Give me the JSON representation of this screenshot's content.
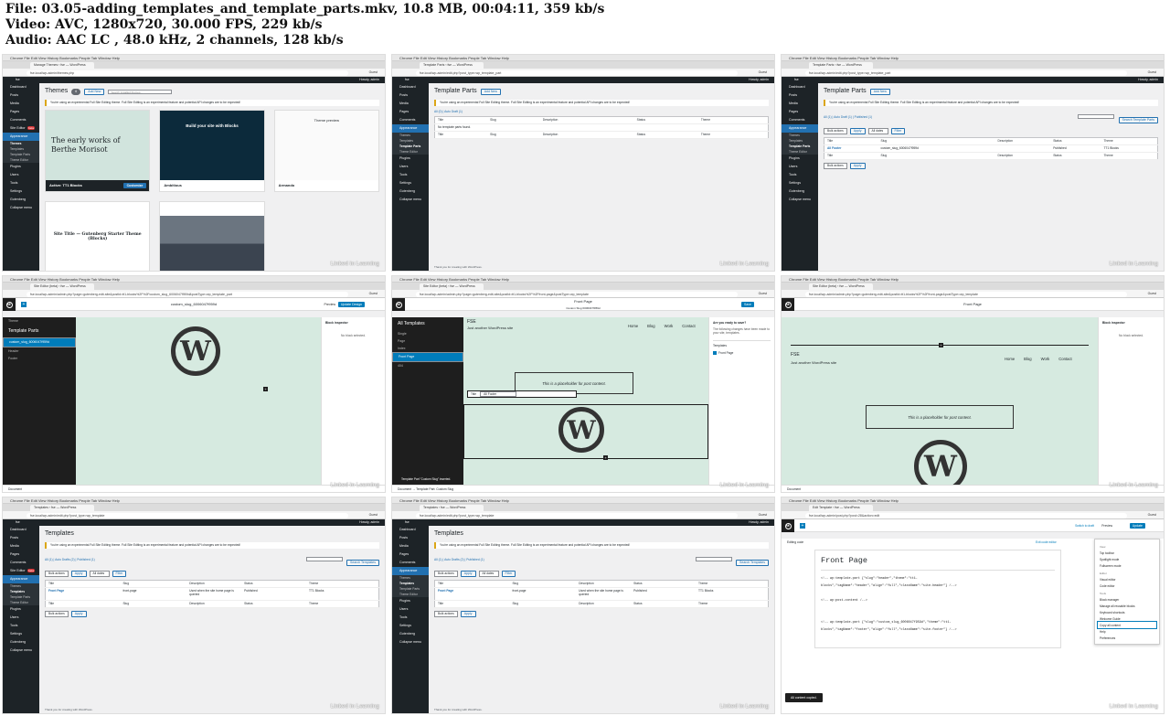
{
  "header": {
    "file_line": "File: 03.05-adding_templates_and_template_parts.mkv, 10.8 MB, 00:04:11, 359 kb/s",
    "video_line": "Video: AVC, 1280x720, 30.000 FPS, 229 kb/s",
    "audio_line": "Audio: AAC LC , 48.0 kHz, 2 channels, 128 kb/s"
  },
  "chrome": {
    "os_menu": "Chrome  File  Edit  View  History  Bookmarks  People  Tab  Window  Help",
    "guest": "Guest",
    "not_secure": "Not Secure"
  },
  "admin": {
    "site": "fse",
    "howdy": "Howdy, admin",
    "menu": [
      "Dashboard",
      "Posts",
      "Media",
      "Pages",
      "Comments",
      "Site Editor",
      "Appearance",
      "Plugins",
      "Users",
      "Tools",
      "Settings",
      "Gutenberg",
      "Collapse menu"
    ],
    "beta": "beta",
    "appearance_sub": [
      "Themes",
      "Templates",
      "Template Parts",
      "Theme Editor"
    ],
    "notice": "You're using an experimental Full Site Editing theme. Full Site Editing is an experimental feature and potential API changes are to be expected!",
    "thanks": "Thank you for creating with WordPress.",
    "version": "Version 5.8",
    "bulk": "Bulk actions",
    "apply": "Apply",
    "all_dates": "All dates",
    "filter": "Filter",
    "col_title": "Title",
    "col_slug": "Slug",
    "col_desc": "Description",
    "col_status": "Status",
    "col_theme": "Theme"
  },
  "linkedin": "Linked in Learning",
  "thumbs": {
    "t1": {
      "tab": "Manage Themes ‹ fse — WordPress",
      "url": "fse.local/wp-admin/themes.php",
      "title": "Themes",
      "count": "6",
      "add_new": "Add New",
      "search_ph": "Search installed themes...",
      "themes": [
        {
          "name": "Active: TT1 Blocks",
          "headline": "The early works of Berthe Morisot",
          "action": "Customize"
        },
        {
          "name": "Ambitious",
          "headline": "Build your site with Blocks"
        },
        {
          "name": "Armando",
          "headline": "Theme preview"
        },
        {
          "name": "",
          "headline": "Site Title — Gutenberg Starter Theme (Blocks)"
        },
        {
          "name": "",
          "headline": ""
        }
      ]
    },
    "t2": {
      "tab": "Template Parts ‹ fse — WordPress",
      "url": "fse.local/wp-admin/edit.php?post_type=wp_template_part",
      "title": "Template Parts",
      "add_new": "Add New",
      "subsub": "All (0) | Auto Draft (1)",
      "empty": "No template parts found."
    },
    "t3": {
      "tab": "Template Parts ‹ fse — WordPress",
      "url": "fse.local/wp-admin/edit.php?post_type=wp_template_part",
      "title": "Template Parts",
      "add_new": "Add New",
      "subsub": "All (1) | Auto Draft (1) | Published (1)",
      "search_btn": "Search Template Parts",
      "row_title": "All Footer",
      "row_slug": "custom_slug_6006047f959d",
      "row_status": "Published",
      "row_theme": "TT1 Blocks",
      "items": "1 item"
    },
    "t4": {
      "tab": "Site Editor (beta) ‹ fse — WordPress",
      "url": "fse.local/wp-admin/admin.php?page=gutenberg-edit-site&postId=tt1-blocks%2F%2Fcustom_slug_6006047f959d&postType=wp_template_part",
      "doc": "custom_slug_6006047f959d",
      "preview": "Preview",
      "update": "Update Design",
      "back": "Theme",
      "panel": "Template Parts",
      "item": "custom_slug_6006047f959d",
      "headers": "Header",
      "footers": "Footer",
      "inspector": "Block inspector",
      "noblock": "No block selected.",
      "status": "Document"
    },
    "t5": {
      "tab": "Site Editor (beta) ‹ fse — WordPress",
      "url": "fse.local/wp-admin/admin.php?page=gutenberg-edit-site&postId=tt1-blocks%2F%2Ffront-page&postType=wp_template",
      "doc": "Front Page",
      "doc_sub": "Custom Slug 6006047f959d",
      "panel": "All Templates",
      "items": [
        "Single",
        "Page",
        "Index",
        "Front Page",
        "404"
      ],
      "site_title": "FSE",
      "tagline": "Just another WordPress site",
      "nav": [
        "Home",
        "Blog",
        "Work",
        "Contact"
      ],
      "placeholder": "This is a placeholder for post content.",
      "toolbar_title": "Title",
      "toolbar_select": "All Footer",
      "ready": "Are you ready to save?",
      "ready_desc": "The following changes have been made to your site, templates.",
      "templates": "Templates",
      "front_page": "Front Page",
      "save": "Save",
      "toast": "Template Part \"Custom Slug\" inserted.",
      "status": "Document → Template Part: Custom Slug"
    },
    "t6": {
      "tab": "Site Editor (beta) ‹ fse — WordPress",
      "url": "fse.local/wp-admin/admin.php?page=gutenberg-edit-site&postId=tt1-blocks%2F%2Ffront-page&postType=wp_template",
      "doc": "Front Page",
      "site_title": "FSE",
      "tagline": "Just another WordPress site",
      "nav": [
        "Home",
        "Blog",
        "Work",
        "Contact"
      ],
      "placeholder": "This is a placeholder for post content.",
      "inspector": "Block inspector",
      "noblock": "No block selected.",
      "status": "Document"
    },
    "t7": {
      "tab": "Templates ‹ fse — WordPress",
      "url": "fse.local/wp-admin/edit.php?post_type=wp_template",
      "title": "Templates",
      "subsub": "All (1) | Auto Drafts (2) | Published (1)",
      "search_btn": "Search Templates",
      "row_title": "Front Page",
      "row_slug": "front-page",
      "row_desc": "Used when the site home page is queried",
      "row_status": "Published",
      "row_theme": "TT1 Blocks",
      "items": "1 item"
    },
    "t8": {
      "tab": "Templates ‹ fse — WordPress",
      "url": "fse.local/wp-admin/edit.php?post_type=wp_template",
      "title": "Templates",
      "subsub": "All (1) | Auto Drafts (2) | Published (1)",
      "search_btn": "Search Templates",
      "row_title": "Front Page",
      "row_slug": "front-page",
      "row_desc": "Used when the site home page is queried",
      "row_status": "Published",
      "row_theme": "TT1 Blocks",
      "items": "1 item"
    },
    "t9": {
      "tab": "Edit Template ‹ fse — WordPress",
      "url": "fse.local/wp-admin/post.php?post=28&action=edit",
      "editing": "Editing code",
      "exit": "Exit code editor",
      "switch": "Switch to draft",
      "preview": "Preview",
      "update": "Update",
      "code_title": "Front Page",
      "code": "<!-- wp:template-part {\"slug\":\"header\",\"theme\":\"tt1-\nblocks\",\"tagName\":\"header\",\"align\":\"full\",\"className\":\"site-header\"} /-->\n\n<!-- wp:post-content /-->\n\n\n<!-- wp:template-part {\"slug\":\"custom_slug_6006047f959d\",\"theme\":\"tt1-\nblocks\",\"tagName\":\"footer\",\"align\":\"full\",\"className\":\"site-footer\"} /-->",
      "menu": {
        "view": "View",
        "top_toolbar": "Top toolbar",
        "spotlight": "Spotlight mode",
        "fullscreen": "Fullscreen mode",
        "editor": "Editor",
        "visual": "Visual editor",
        "code": "Code editor",
        "tools": "Tools",
        "block_manager": "Block manager",
        "reusable": "Manage all reusable blocks",
        "shortcuts": "Keyboard shortcuts",
        "welcome": "Welcome Guide",
        "copy": "Copy all content",
        "help": "Help",
        "prefs": "Preferences"
      },
      "snackbar": "All content copied."
    }
  }
}
